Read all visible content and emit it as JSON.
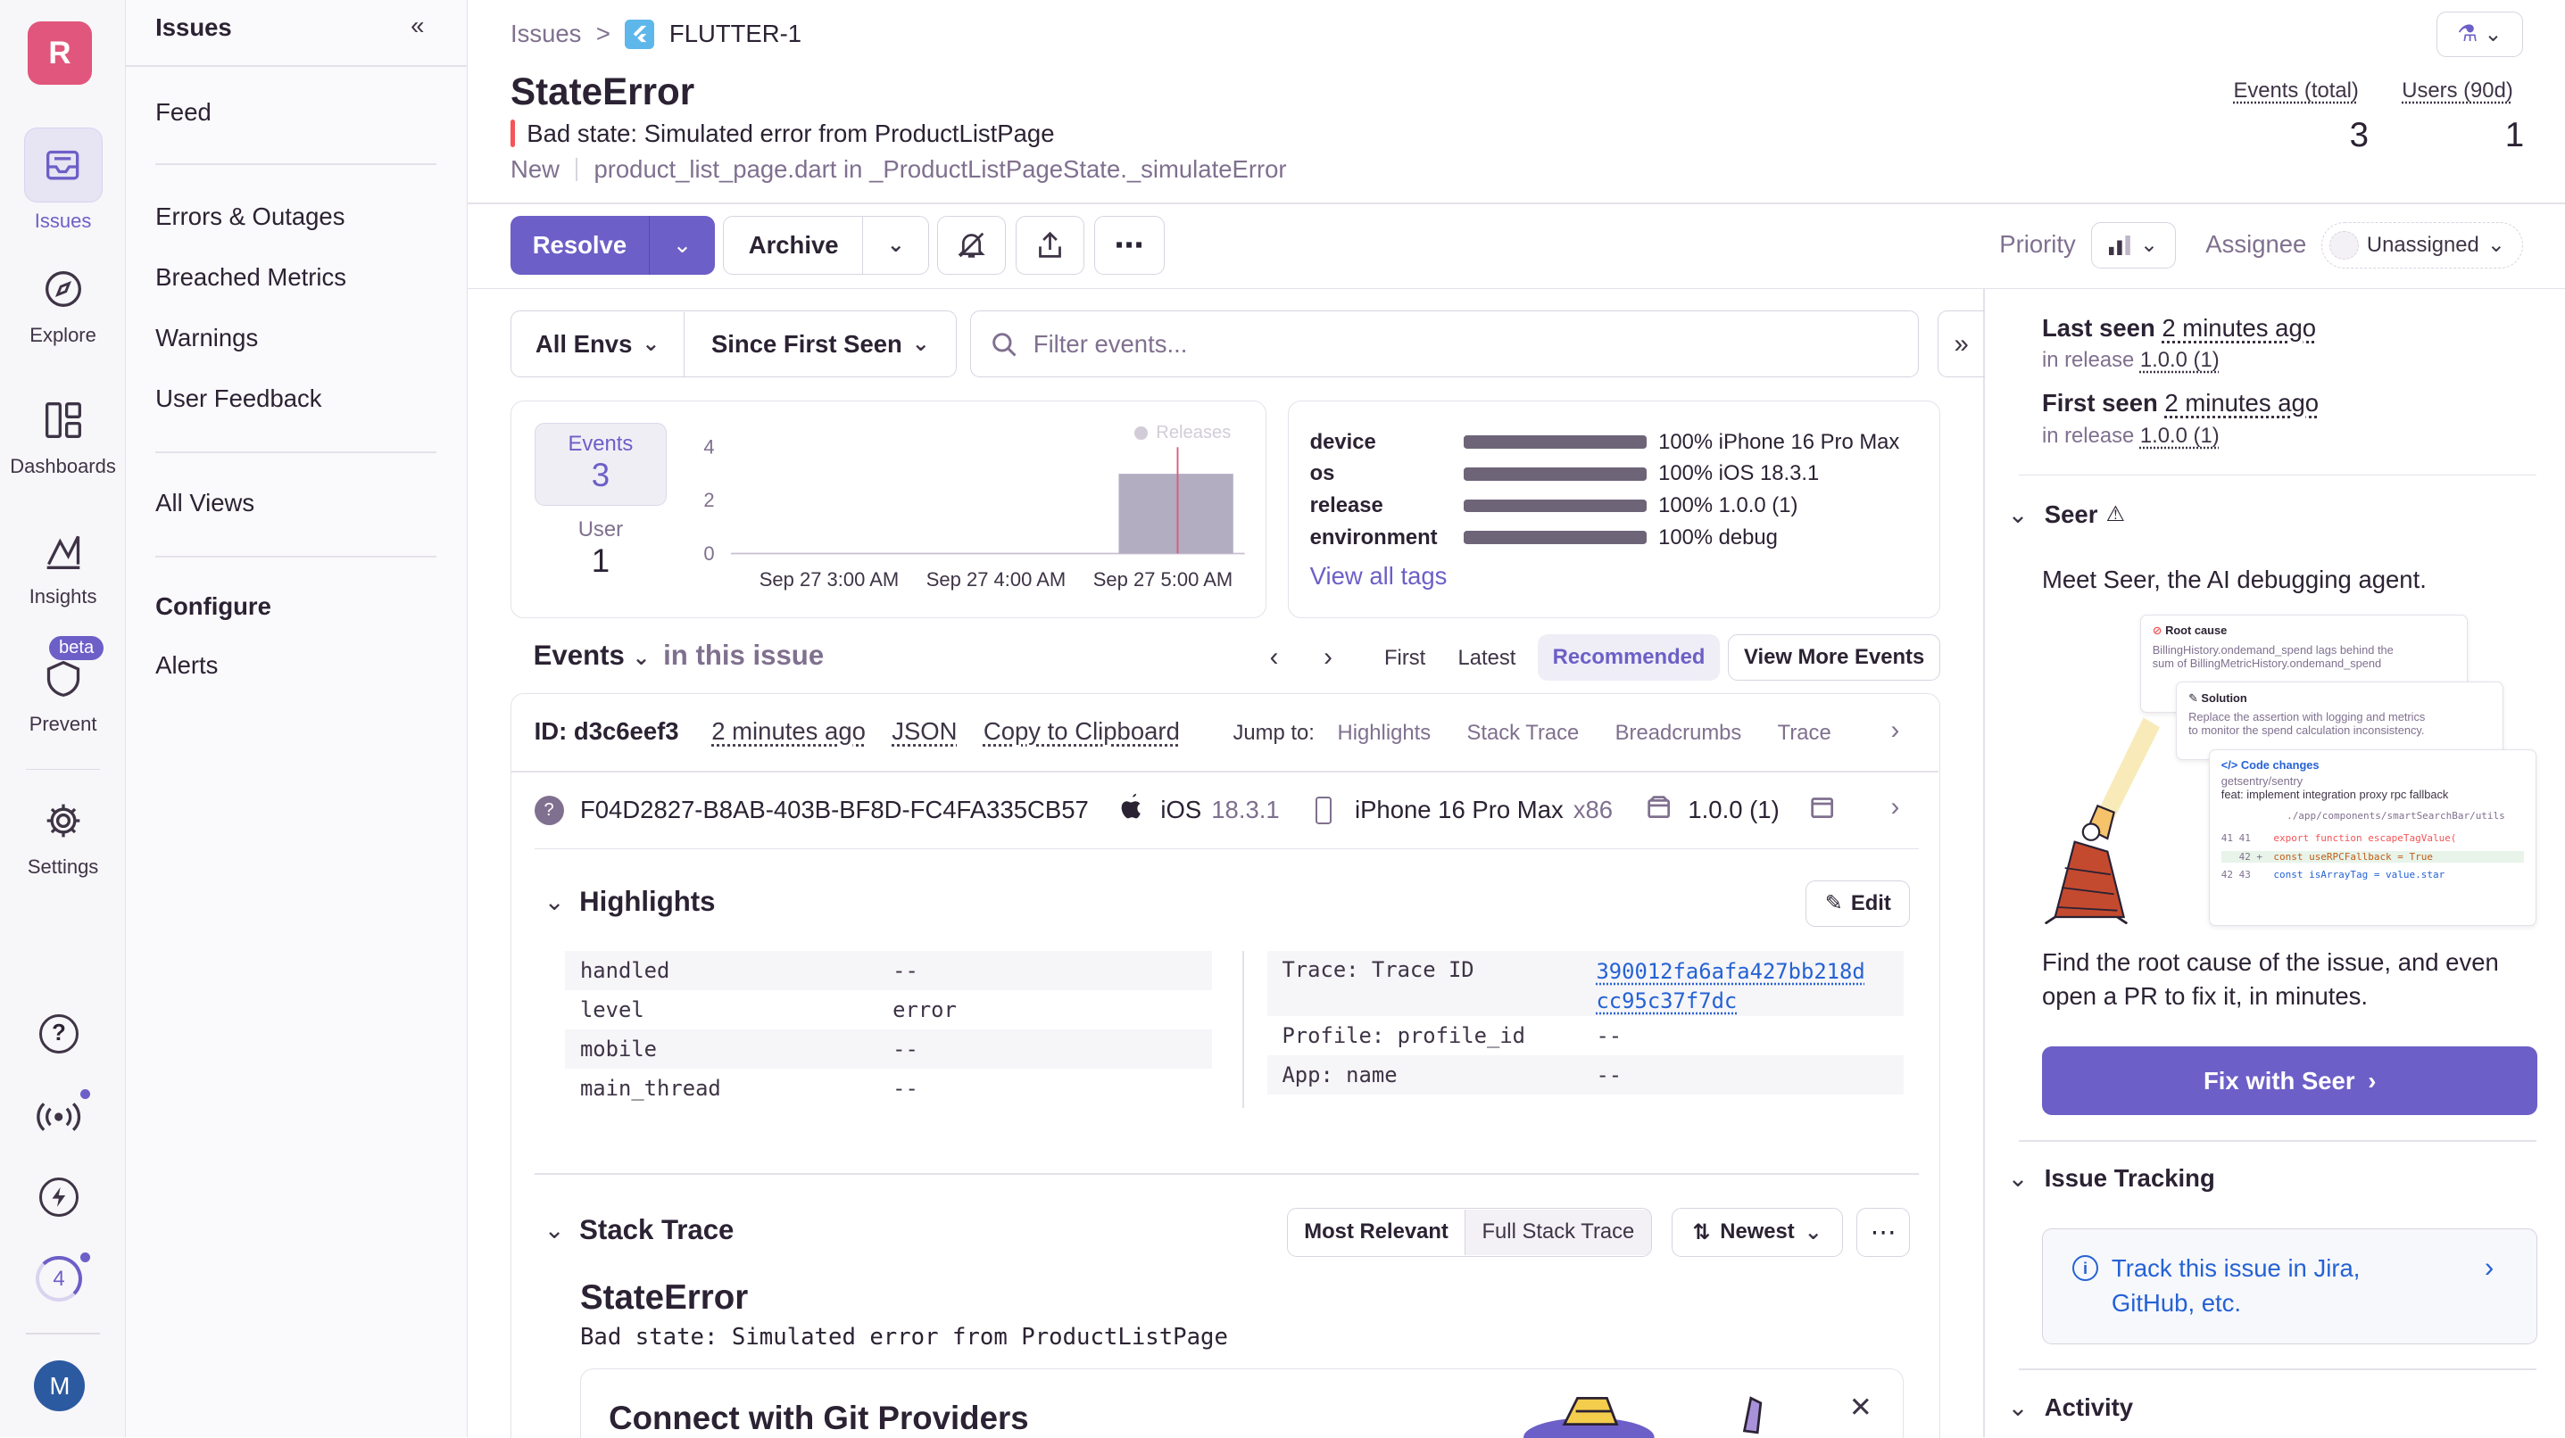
{
  "rail": {
    "org_initial": "R",
    "items": [
      {
        "label": "Issues",
        "icon": "inbox-icon"
      },
      {
        "label": "Explore",
        "icon": "compass-icon"
      },
      {
        "label": "Dashboards",
        "icon": "dashboard-icon"
      },
      {
        "label": "Insights",
        "icon": "graph-icon"
      },
      {
        "label": "Prevent",
        "icon": "shield-icon",
        "badge": "beta"
      },
      {
        "label": "Settings",
        "icon": "gear-icon"
      }
    ],
    "onboarding_count": "4",
    "user_initial": "M"
  },
  "sidebar": {
    "title": "Issues",
    "feed": "Feed",
    "items": [
      "Errors & Outages",
      "Breached Metrics",
      "Warnings",
      "User Feedback"
    ],
    "all_views": "All Views",
    "configure": "Configure",
    "alerts": "Alerts"
  },
  "breadcrumb": {
    "root": "Issues",
    "sep": ">",
    "issue": "FLUTTER-1"
  },
  "issue": {
    "title": "StateError",
    "message": "Bad state: Simulated error from ProductListPage",
    "status": "New",
    "location": "product_list_page.dart in _ProductListPageState._simulateError"
  },
  "stats": {
    "events_label": "Events (total)",
    "events_value": "3",
    "users_label": "Users (90d)",
    "users_value": "1"
  },
  "actions": {
    "resolve": "Resolve",
    "archive": "Archive",
    "priority_label": "Priority",
    "assignee_label": "Assignee",
    "assignee_value": "Unassigned"
  },
  "filters": {
    "env": "All Envs",
    "time": "Since First Seen",
    "search_placeholder": "Filter events..."
  },
  "graph": {
    "events_label": "Events",
    "events_value": "3",
    "user_label": "User",
    "user_value": "1",
    "releases_label": "Releases",
    "yticks": [
      "4",
      "2",
      "0"
    ],
    "xticks": [
      "Sep 27 3:00 AM",
      "Sep 27 4:00 AM",
      "Sep 27 5:00 AM"
    ]
  },
  "chart_data": {
    "type": "bar",
    "categories": [
      "Sep 27 3:00 AM",
      "Sep 27 4:00 AM",
      "Sep 27 5:00 AM"
    ],
    "values": [
      0,
      0,
      3
    ],
    "ylim": [
      0,
      4
    ]
  },
  "tags": {
    "rows": [
      {
        "key": "device",
        "value": "100% iPhone 16 Pro Max",
        "pct": 1.0
      },
      {
        "key": "os",
        "value": "100% iOS 18.3.1",
        "pct": 1.0
      },
      {
        "key": "release",
        "value": "100% 1.0.0 (1)",
        "pct": 1.0
      },
      {
        "key": "environment",
        "value": "100% debug",
        "pct": 1.0
      }
    ],
    "view_all": "View all tags"
  },
  "events_nav": {
    "title": "Events",
    "subtitle": "in this issue",
    "first": "First",
    "latest": "Latest",
    "recommended": "Recommended",
    "view_more": "View More Events"
  },
  "event": {
    "id": "ID: d3c6eef3",
    "time": "2 minutes ago",
    "json": "JSON",
    "copy": "Copy to Clipboard",
    "jump_to": "Jump to:",
    "jumps": [
      "Highlights",
      "Stack Trace",
      "Breadcrumbs",
      "Trace"
    ],
    "device_id": "F04D2827-B8AB-403B-BF8D-FC4FA335CB57",
    "os_name": "iOS",
    "os_ver": "18.3.1",
    "device": "iPhone 16 Pro Max",
    "arch": "x86",
    "release": "1.0.0 (1)"
  },
  "highlights": {
    "title": "Highlights",
    "edit": "Edit",
    "left": [
      {
        "k": "handled",
        "v": "--"
      },
      {
        "k": "level",
        "v": "error"
      },
      {
        "k": "mobile",
        "v": "--"
      },
      {
        "k": "main_thread",
        "v": "--"
      }
    ],
    "trace_k": "Trace: Trace ID",
    "trace_v1": "390012fa6afa427bb218d",
    "trace_v2": "cc95c37f7dc",
    "profile_k": "Profile: profile_id",
    "profile_v": "--",
    "app_k": "App: name",
    "app_v": "--"
  },
  "stack": {
    "title": "Stack Trace",
    "most_relevant": "Most Relevant",
    "full": "Full Stack Trace",
    "sort": "Newest",
    "exc_title": "StateError",
    "exc_msg": "Bad state: Simulated error from ProductListPage",
    "git_title": "Connect with Git Providers"
  },
  "right": {
    "last_seen_label": "Last seen",
    "last_seen": "2 minutes ago",
    "last_release_prefix": "in release",
    "last_release": "1.0.0 (1)",
    "first_seen_label": "First seen",
    "first_seen": "2 minutes ago",
    "first_release_prefix": "in release",
    "first_release": "1.0.0 (1)",
    "seer_title": "Seer",
    "seer_intro": "Meet Seer, the AI debugging agent.",
    "seer_illus": {
      "root_cause": "Root cause",
      "root_text1": "BillingHistory.ondemand_spend lags behind the",
      "root_text2": "sum of BillingMetricHistory.ondemand_spend",
      "solution": "Solution",
      "sol_text1": "Replace the assertion with logging and metrics",
      "sol_text2": "to monitor the spend calculation inconsistency.",
      "code": "Code changes",
      "repo": "getsentry/sentry",
      "commit": "feat: implement integration proxy rpc fallback",
      "path": "./app/components/smartSearchBar/utils",
      "l1": "export function escapeTagValue(",
      "l2": "const useRPCFallback = True",
      "l3": "const isArrayTag = value.star"
    },
    "seer_desc": "Find the root cause of the issue, and even open a PR to fix it, in minutes.",
    "fix_button": "Fix with Seer",
    "tracking_title": "Issue Tracking",
    "tracking_link": "Track this issue in Jira, GitHub, etc.",
    "activity_title": "Activity"
  },
  "colors": {
    "accent": "#6c5fc7",
    "brand_pink": "#e1567c",
    "error_orange": "#f55459",
    "link": "#2562d4"
  }
}
